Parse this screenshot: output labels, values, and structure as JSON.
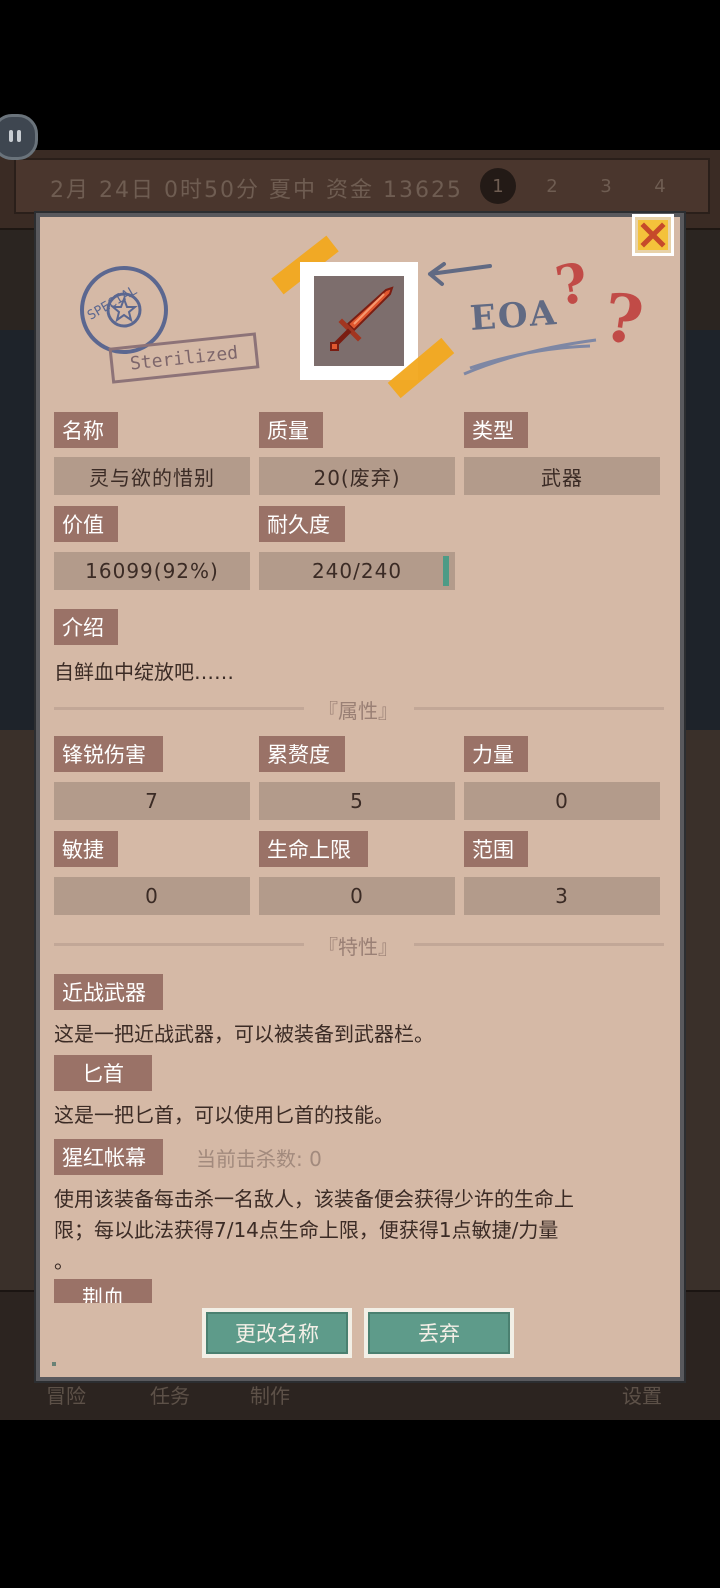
{
  "background": {
    "date_line": "2月  24日  0时50分  夏中  资金  13625",
    "pages": [
      "1",
      "2",
      "3",
      "4"
    ],
    "nav": [
      "冒险",
      "任务",
      "制作",
      "设置"
    ]
  },
  "header": {
    "stamp_text": "Sterilized",
    "stamp_circle_text": "SPECIAL",
    "eoa_text": "EOA",
    "question_marks": "??"
  },
  "labels": {
    "name": "名称",
    "quality": "质量",
    "type": "类型",
    "value": "价值",
    "durability": "耐久度",
    "intro": "介绍"
  },
  "fields": {
    "name": "灵与欲的惜别",
    "quality": "20(废弃)",
    "type": "武器",
    "value": "16099(92%)",
    "durability": "240/240"
  },
  "durability_fraction": 1.0,
  "intro_text": "自鲜血中绽放吧……",
  "sections": {
    "attributes": "『属性』",
    "traits": "『特性』"
  },
  "attributes": [
    {
      "label": "锋锐伤害",
      "value": "7"
    },
    {
      "label": "累赘度",
      "value": "5"
    },
    {
      "label": "力量",
      "value": "0"
    },
    {
      "label": "敏捷",
      "value": "0"
    },
    {
      "label": "生命上限",
      "value": "0"
    },
    {
      "label": "范围",
      "value": "3"
    }
  ],
  "traits": [
    {
      "label": "近战武器",
      "desc": "这是一把近战武器，可以被装备到武器栏。"
    },
    {
      "label": "匕首",
      "desc": "这是一把匕首，可以使用匕首的技能。"
    },
    {
      "label": "猩红帐幕",
      "kills": "当前击杀数: 0",
      "desc_lines": [
        "使用该装备每击杀一名敌人，该装备便会获得少许的生命上",
        "限；每以此法获得7/14点生命上限，便获得1点敏捷/力量",
        "。"
      ]
    },
    {
      "label": "荆血"
    }
  ],
  "buttons": {
    "rename": "更改名称",
    "discard": "丢弃"
  },
  "colors": {
    "card_bg": "#d5b9a6",
    "label_bg": "#9a7267",
    "field_bg": "#b39b8b",
    "button_bg": "#5e9b8a",
    "close_bg": "#f4c23b"
  }
}
